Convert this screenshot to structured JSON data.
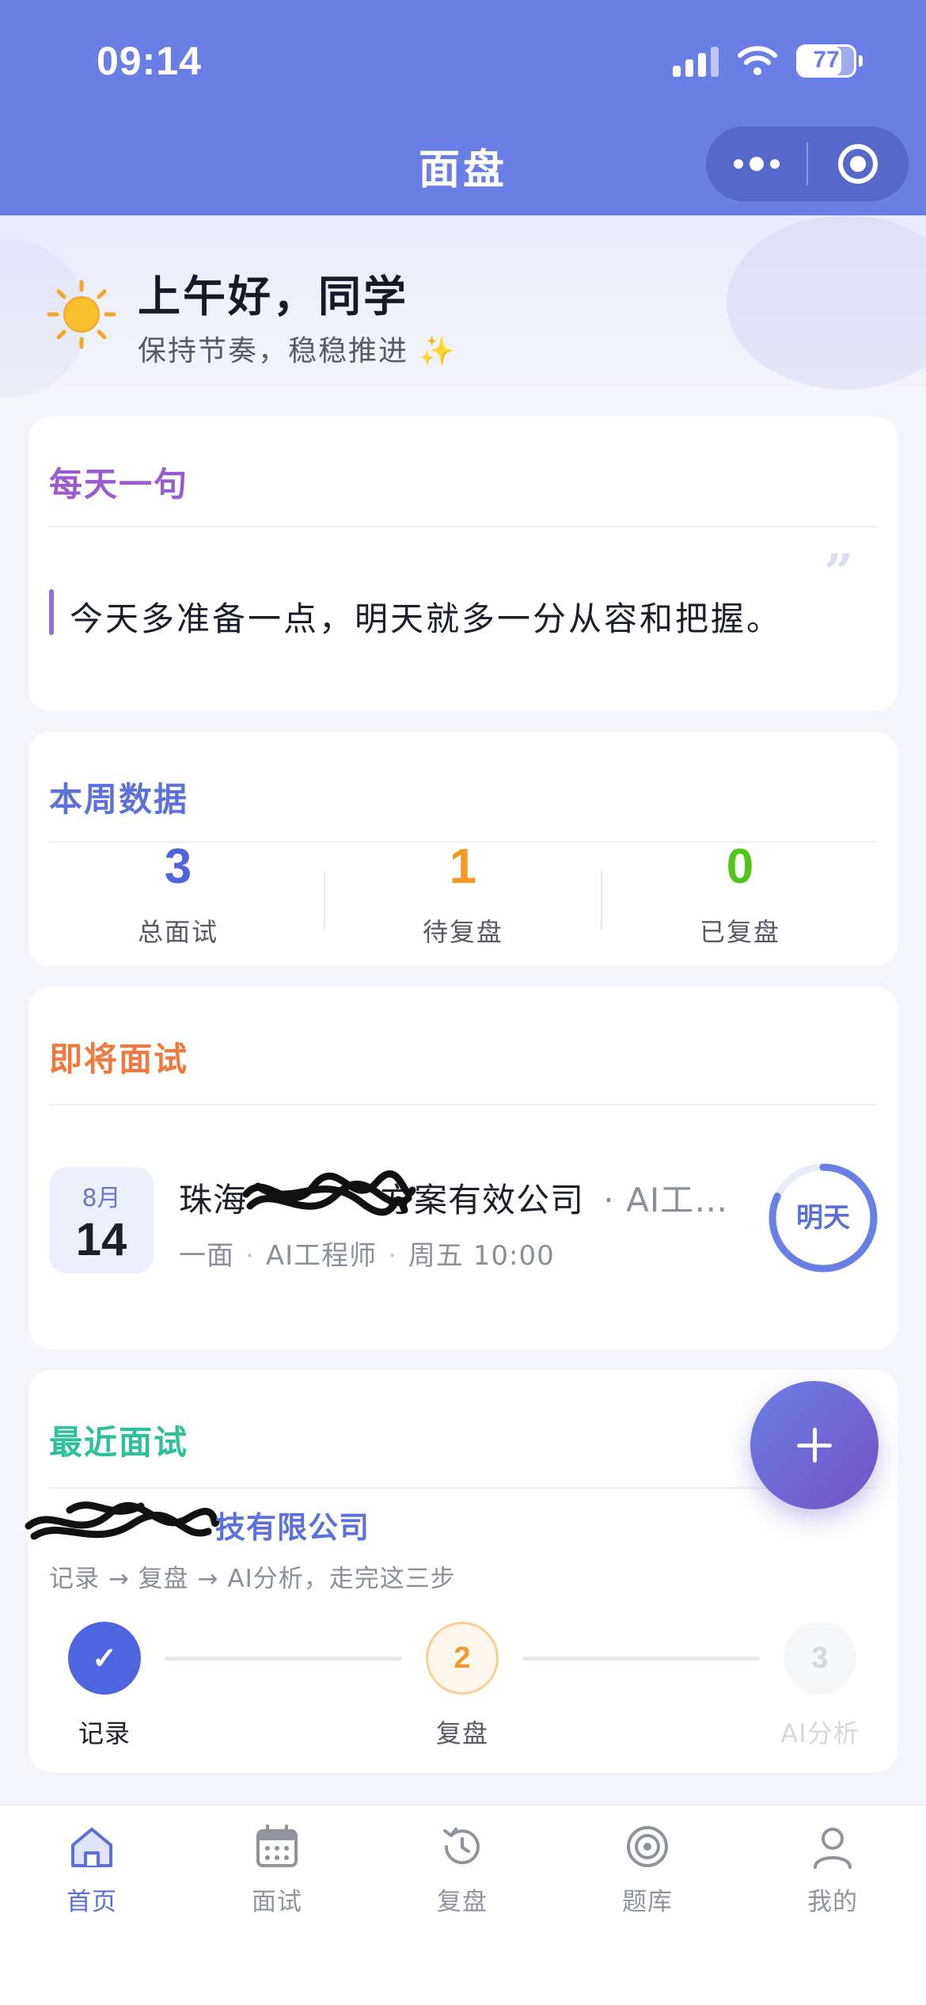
{
  "status_bar": {
    "time": "09:14",
    "battery": "77",
    "battery_level": 0.77
  },
  "nav": {
    "title": "面盘"
  },
  "greeting": {
    "title": "上午好，同学",
    "subtitle": "保持节奏，稳稳推进",
    "emoji": "✨"
  },
  "quote_card": {
    "title": "每天一句",
    "quote_mark": "”",
    "text": "今天多准备一点，明天就多一分从容和把握。"
  },
  "weekly_stats": {
    "title": "本周数据",
    "items": [
      {
        "value": "3",
        "label": "总面试",
        "color": "#4f65d9"
      },
      {
        "value": "1",
        "label": "待复盘",
        "color": "#f29a25"
      },
      {
        "value": "0",
        "label": "已复盘",
        "color": "#52c41a"
      }
    ]
  },
  "upcoming": {
    "title": "即将面试",
    "date_month": "8月",
    "date_day": "14",
    "company": "珠海",
    "company_tail": "方案有效公司",
    "position_suffix": "· AI工…",
    "round": "一面",
    "role": "AI工程师",
    "time": "周五 10:00",
    "countdown": "明天",
    "countdown_progress": 0.82
  },
  "recent": {
    "title": "最近面试",
    "company": "技有限公司",
    "hint": "记录 → 复盘 → AI分析，走完这三步",
    "steps": [
      {
        "num": "✓",
        "label": "记录",
        "state": "done"
      },
      {
        "num": "2",
        "label": "复盘",
        "state": "current"
      },
      {
        "num": "3",
        "label": "AI分析",
        "state": "pending"
      }
    ]
  },
  "fab": {
    "icon": "plus-icon"
  },
  "tabbar": {
    "items": [
      {
        "label": "首页",
        "icon": "home-icon",
        "active": true
      },
      {
        "label": "面试",
        "icon": "calendar-icon",
        "active": false
      },
      {
        "label": "复盘",
        "icon": "history-icon",
        "active": false
      },
      {
        "label": "题库",
        "icon": "target-icon",
        "active": false
      },
      {
        "label": "我的",
        "icon": "user-icon",
        "active": false
      }
    ]
  },
  "colors": {
    "brand": "#6a7fe6",
    "quote_title": "#9a5ad0",
    "stats_title": "#5c72d8",
    "upcoming_title": "#ef7a3f",
    "recent_title": "#2fc09a",
    "tab_active": "#5b6fd8"
  }
}
